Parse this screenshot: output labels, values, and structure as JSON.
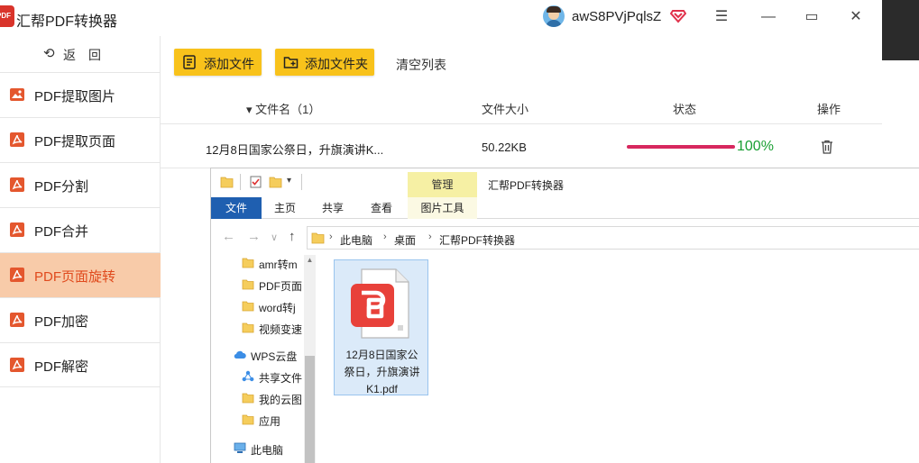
{
  "app": {
    "title": "汇帮PDF转换器",
    "username": "awS8PVjPqlsZ",
    "window_controls": {
      "menu": "☰",
      "minimize": "—",
      "maximize": "▭",
      "close": "✕"
    }
  },
  "sidebar": {
    "back_arrow": "⟲",
    "back_label": "返回",
    "items": [
      {
        "label": "PDF提取图片",
        "icon": "image-icon"
      },
      {
        "label": "PDF提取页面",
        "icon": "pdf-icon"
      },
      {
        "label": "PDF分割",
        "icon": "pdf-icon"
      },
      {
        "label": "PDF合并",
        "icon": "pdf-icon"
      },
      {
        "label": "PDF页面旋转",
        "icon": "pdf-icon",
        "active": true
      },
      {
        "label": "PDF加密",
        "icon": "pdf-icon"
      },
      {
        "label": "PDF解密",
        "icon": "pdf-icon"
      }
    ]
  },
  "toolbar": {
    "add_file": "添加文件",
    "add_folder": "添加文件夹",
    "clear_list": "清空列表"
  },
  "table": {
    "headers": {
      "name": "▾ 文件名（1）",
      "size": "文件大小",
      "status": "状态",
      "action": "操作"
    },
    "rows": [
      {
        "name": "12月8日国家公祭日，升旗演讲K...",
        "size": "50.22KB",
        "progress": 1.0,
        "percent": "100%"
      }
    ]
  },
  "explorer": {
    "ribbon_context": "管理",
    "ribbon_title": "汇帮PDF转换器",
    "tabs": {
      "file": "文件",
      "home": "主页",
      "share": "共享",
      "view": "查看",
      "picture_tools": "图片工具"
    },
    "nav": {
      "back": "←",
      "forward": "→",
      "recent": "∨",
      "up": "↑"
    },
    "breadcrumb": [
      "此电脑",
      "桌面",
      "汇帮PDF转换器"
    ],
    "tree": [
      {
        "label": "amr转m",
        "icon": "folder-icon"
      },
      {
        "label": "PDF页面",
        "icon": "folder-icon"
      },
      {
        "label": "word转j",
        "icon": "folder-icon"
      },
      {
        "label": "视频变速",
        "icon": "folder-icon"
      },
      {
        "label": "WPS云盘",
        "icon": "cloud-icon"
      },
      {
        "label": "共享文件",
        "icon": "share-icon"
      },
      {
        "label": "我的云图",
        "icon": "folder-icon"
      },
      {
        "label": "应用",
        "icon": "folder-icon"
      },
      {
        "label": "此电脑",
        "icon": "computer-icon"
      }
    ],
    "file": {
      "name_line1": "12月8日国家公",
      "name_line2": "祭日，升旗演讲",
      "name_line3": "K1.pdf"
    }
  },
  "colors": {
    "accent_yellow": "#f8c21b",
    "active_nav_bg": "#f8cba9",
    "active_nav_text": "#e04a1d",
    "progress_bar": "#d7285e",
    "progress_text": "#1a9f33",
    "ribbon_file_tab": "#1f5fb0"
  }
}
